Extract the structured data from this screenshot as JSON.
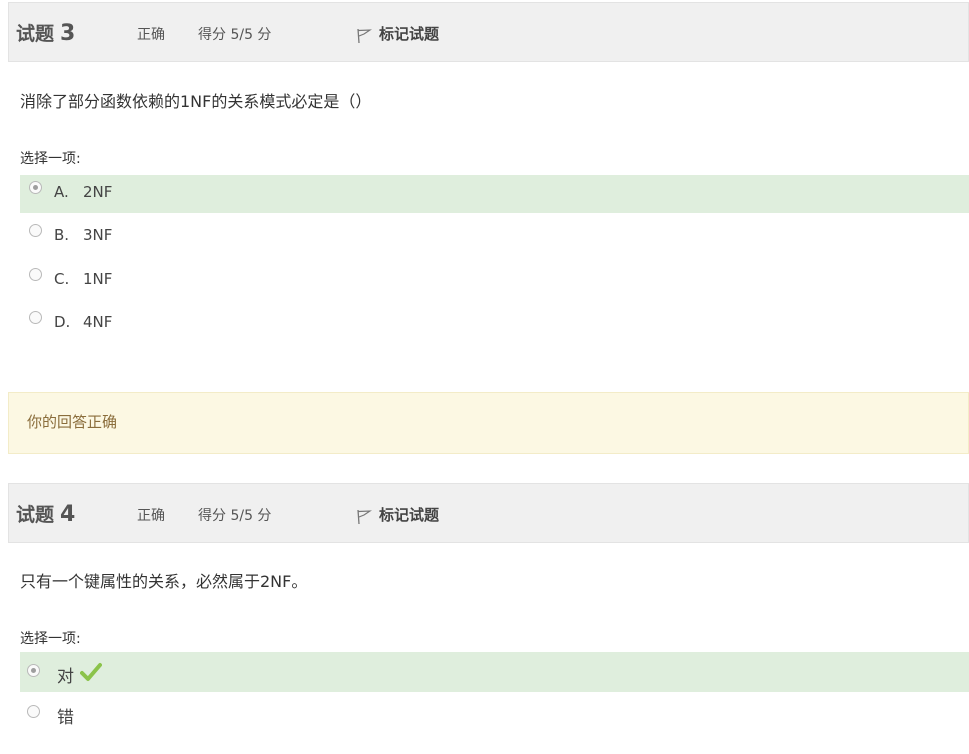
{
  "questions": [
    {
      "title": "试题",
      "number": "3",
      "state": "正确",
      "grade": "得分 5/5 分",
      "flag_label": "标记试题",
      "text": "消除了部分函数依赖的1NF的关系模式必定是（）",
      "prompt": "选择一项:",
      "options": [
        {
          "letter": "A.",
          "text": "2NF",
          "selected": true
        },
        {
          "letter": "B.",
          "text": "3NF",
          "selected": false
        },
        {
          "letter": "C.",
          "text": "1NF",
          "selected": false
        },
        {
          "letter": "D.",
          "text": "4NF",
          "selected": false
        }
      ],
      "feedback": "你的回答正确"
    },
    {
      "title": "试题",
      "number": "4",
      "state": "正确",
      "grade": "得分 5/5 分",
      "flag_label": "标记试题",
      "text": "只有一个键属性的关系，必然属于2NF。",
      "prompt": "选择一项:",
      "options": [
        {
          "text": "对",
          "selected": true,
          "icon": "check-icon"
        },
        {
          "text": "错",
          "selected": false
        }
      ]
    }
  ],
  "colors": {
    "header_bg": "#f0f0f0",
    "correct_bg": "#dfeedd",
    "feedback_bg": "#fcf8e3",
    "feedback_text": "#8a6d3b",
    "check": "#8bc34a"
  }
}
